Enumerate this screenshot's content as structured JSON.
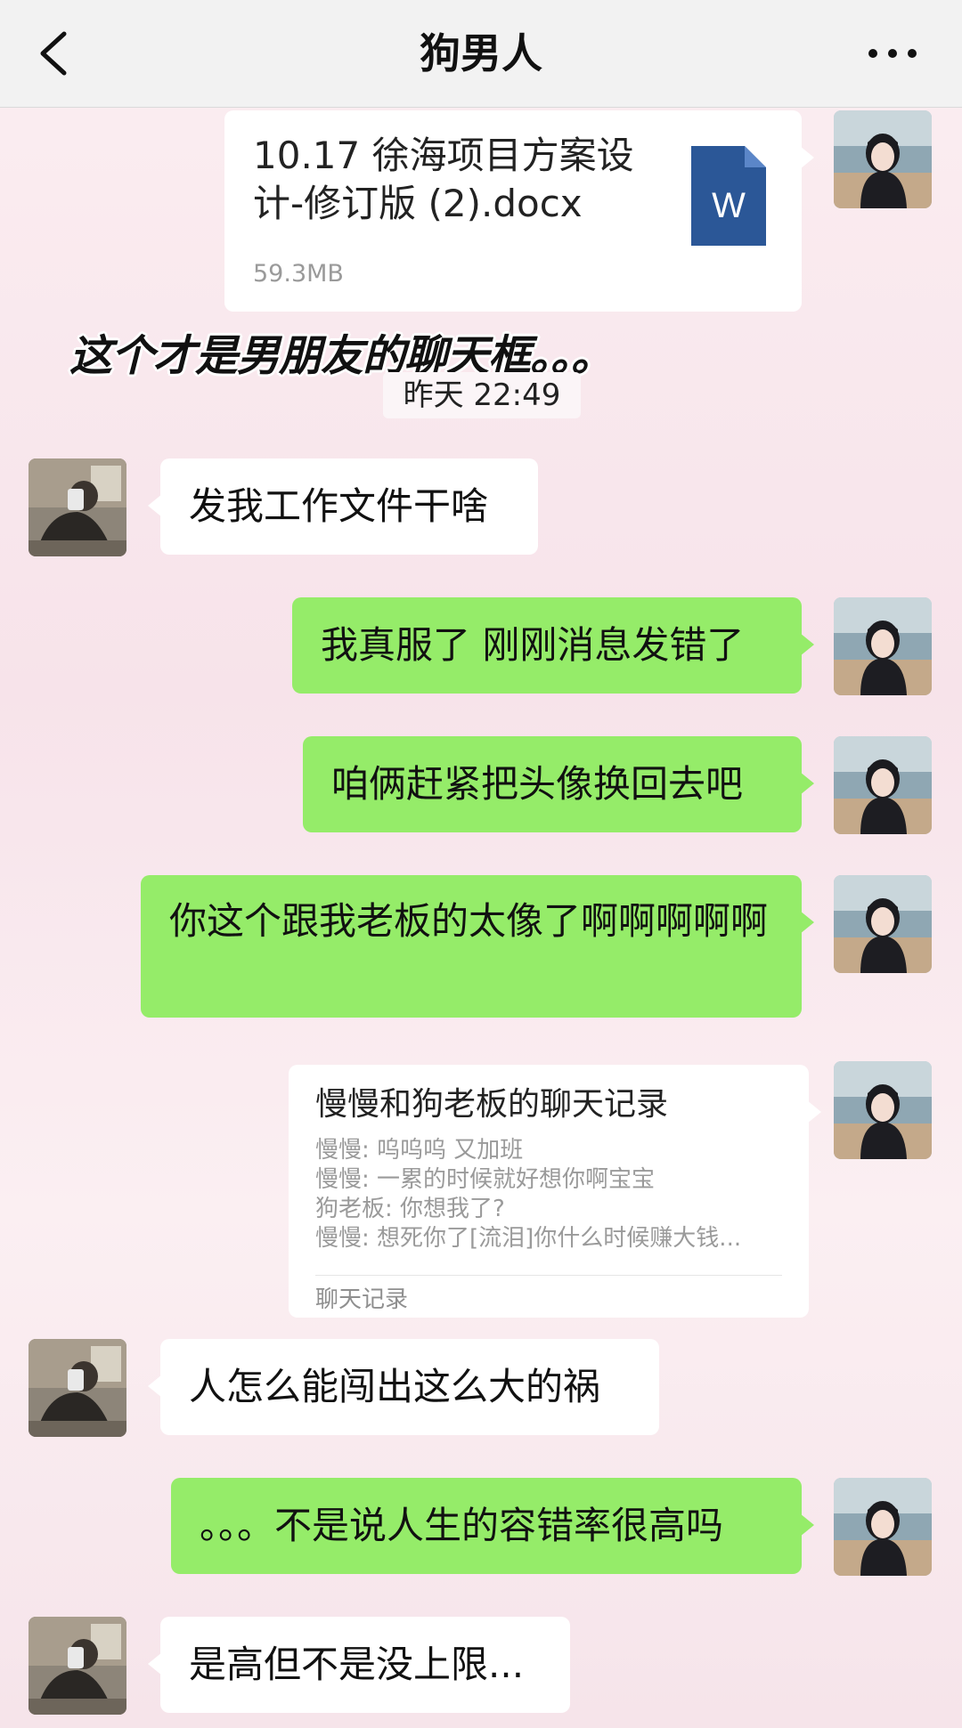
{
  "header": {
    "title": "狗男人"
  },
  "file_message": {
    "name": "10.17 徐海项目方案设计-修订版 (2).docx",
    "size": "59.3MB",
    "icon_letter": "W"
  },
  "caption": "这个才是男朋友的聊天框。。。",
  "timestamp": "昨天 22:49",
  "messages": [
    {
      "side": "left",
      "text": "发我工作文件干啥"
    },
    {
      "side": "right",
      "text": "我真服了 刚刚消息发错了"
    },
    {
      "side": "right",
      "text": "咱俩赶紧把头像换回去吧"
    },
    {
      "side": "right",
      "text": "你这个跟我老板的太像了啊啊啊啊啊"
    },
    {
      "side": "left",
      "text": "人怎么能闯出这么大的祸"
    },
    {
      "side": "right",
      "text": "。。。不是说人生的容错率很高吗"
    },
    {
      "side": "left",
      "text": "是高但不是没上限..."
    }
  ],
  "chat_record": {
    "title": "慢慢和狗老板的聊天记录",
    "lines": [
      "慢慢: 呜呜呜 又加班",
      "慢慢: 一累的时候就好想你啊宝宝",
      "狗老板: 你想我了?",
      "慢慢: 想死你了[流泪]你什么时候赚大钱..."
    ],
    "footer": "聊天记录"
  },
  "colors": {
    "green_bubble": "#95ec69",
    "white_bubble": "#ffffff",
    "word_blue": "#2b5797"
  }
}
